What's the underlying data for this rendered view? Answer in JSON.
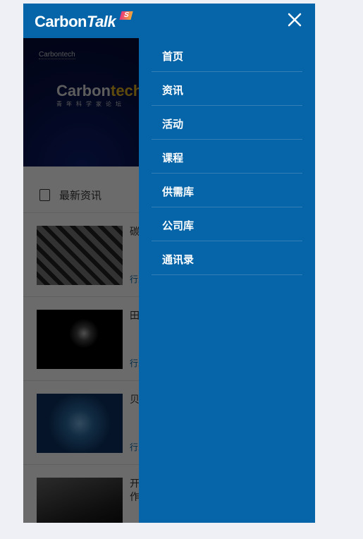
{
  "header": {
    "logo_main": "Carbon",
    "logo_italic": "Talk",
    "logo_badge": "S"
  },
  "banner": {
    "small": "Carbontech",
    "big_a": "Carbon",
    "big_b": "tech",
    "sub": "青年科学家论坛"
  },
  "section": {
    "title": "最新资讯"
  },
  "news": [
    {
      "title": "碳",
      "category": "行业"
    },
    {
      "title": "田",
      "category": "行业"
    },
    {
      "title": "贝",
      "category": "行业"
    },
    {
      "title": "开\n作",
      "category": ""
    }
  ],
  "menu": [
    {
      "label": "首页"
    },
    {
      "label": "资讯"
    },
    {
      "label": "活动"
    },
    {
      "label": "课程"
    },
    {
      "label": "供需库"
    },
    {
      "label": "公司库"
    },
    {
      "label": "通讯录"
    }
  ],
  "colors": {
    "brand": "#0565a8",
    "page_bg": "#eef0f6"
  }
}
